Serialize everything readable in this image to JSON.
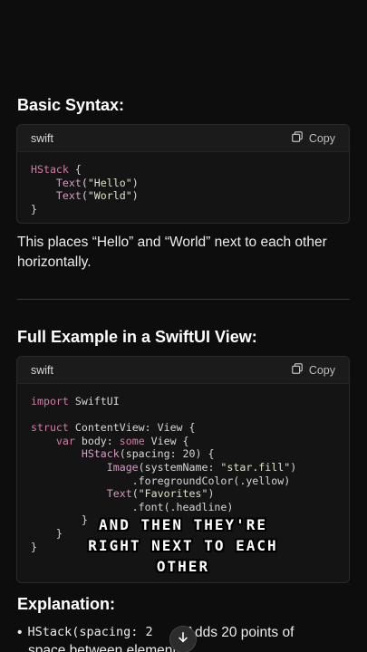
{
  "sections": {
    "basic_syntax_heading": "Basic Syntax:",
    "basic_para": "This places “Hello” and “World” next to each other horizontally.",
    "full_example_heading": "Full Example in a SwiftUI View:",
    "explanation_heading": "Explanation:"
  },
  "code1": {
    "lang": "swift",
    "copy_label": "Copy",
    "lines": [
      "HStack {",
      "    Text(\"Hello\")",
      "    Text(\"World\")",
      "}"
    ]
  },
  "code2": {
    "lang": "swift",
    "copy_label": "Copy"
  },
  "caption": {
    "line1": "AND THEN THEY'RE",
    "line2": "RIGHT NEXT TO EACH",
    "line3": "OTHER"
  },
  "explanation": {
    "bullet_mark": "•",
    "bullet_code": "HStack(spacing: 2",
    "bullet_text": "Adds 20 points of",
    "bullet_cont": "space between elements"
  },
  "icons": {
    "copy": "copy-icon",
    "scroll": "arrow-down-icon"
  }
}
